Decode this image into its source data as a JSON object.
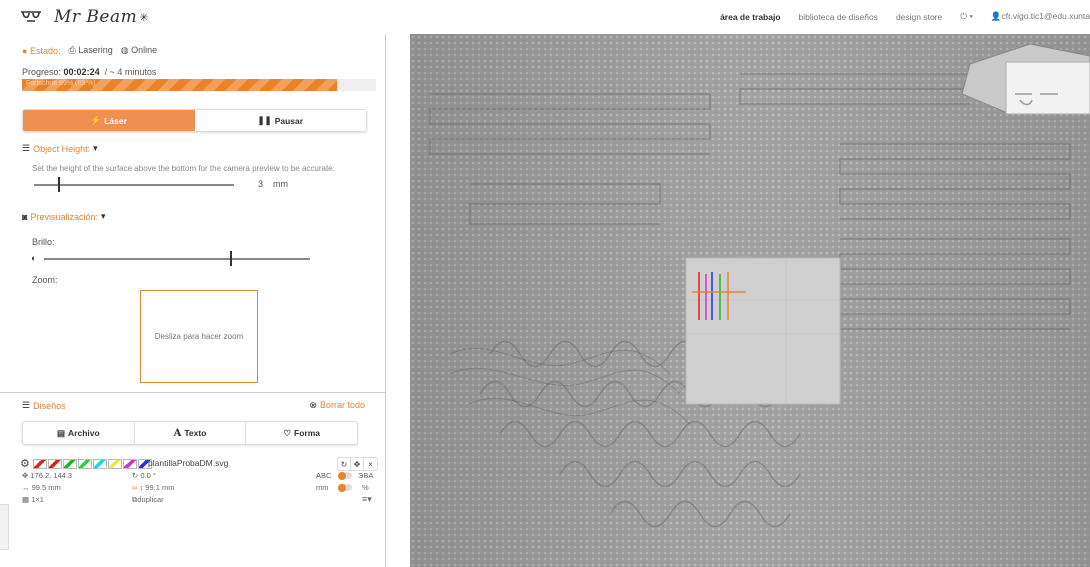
{
  "header": {
    "logo_text": "Mr Beam",
    "nav": {
      "workspace": "área de trabajo",
      "library": "biblioteca de diseños",
      "store": "design store",
      "user": "cfr.vigo.tic1@edu.xunta"
    }
  },
  "status": {
    "label": "Estado:",
    "state": "Lasering",
    "connection": "Online"
  },
  "progress": {
    "label": "Progreso:",
    "elapsed": "00:02:24",
    "remaining": "/ ~ 4 minutos",
    "fraction": 0.89,
    "bar_text": "Fortschritt 89% (89 %)"
  },
  "controls": {
    "laser_label": "Láser",
    "pause_label": "Pausar"
  },
  "object_height": {
    "title": "Object Height:",
    "help": "Set the height of the surface above the bottom for the camera preview to be accurate:",
    "value": "3",
    "unit": "mm",
    "level": 0.12
  },
  "preview": {
    "title": "Previsualización:",
    "brightness_label": "Brillo:",
    "brightness_level": 0.7,
    "zoom_label": "Zoom:",
    "zoom_hint": "Desliza para hacer zoom"
  },
  "designs": {
    "title": "Diseños",
    "clear_label": "Borrar todo",
    "tabs": {
      "file": "Archivo",
      "text": "Texto",
      "shape": "Forma"
    },
    "item": {
      "filename": "plantillaProbaDM.svg",
      "position": "176.2, 144.3",
      "rotation": "0.0 °",
      "width": "99.5 mm",
      "height": "99.1 mm",
      "grid": "1×1",
      "duplicate_label": "duplicar",
      "abc_label": "ABC",
      "caps_label": "ЭBA",
      "mm_label": "mm",
      "pct_label": "%",
      "swatch_colors": [
        "#e02020",
        "#e02020",
        "#22b522",
        "#32d032",
        "#22d4d4",
        "#f0ec30",
        "#d030d0",
        "#2030e0"
      ]
    }
  },
  "colors": {
    "accent": "#e08533",
    "laser_button": "#ee9150",
    "progress": "#e8822b"
  }
}
